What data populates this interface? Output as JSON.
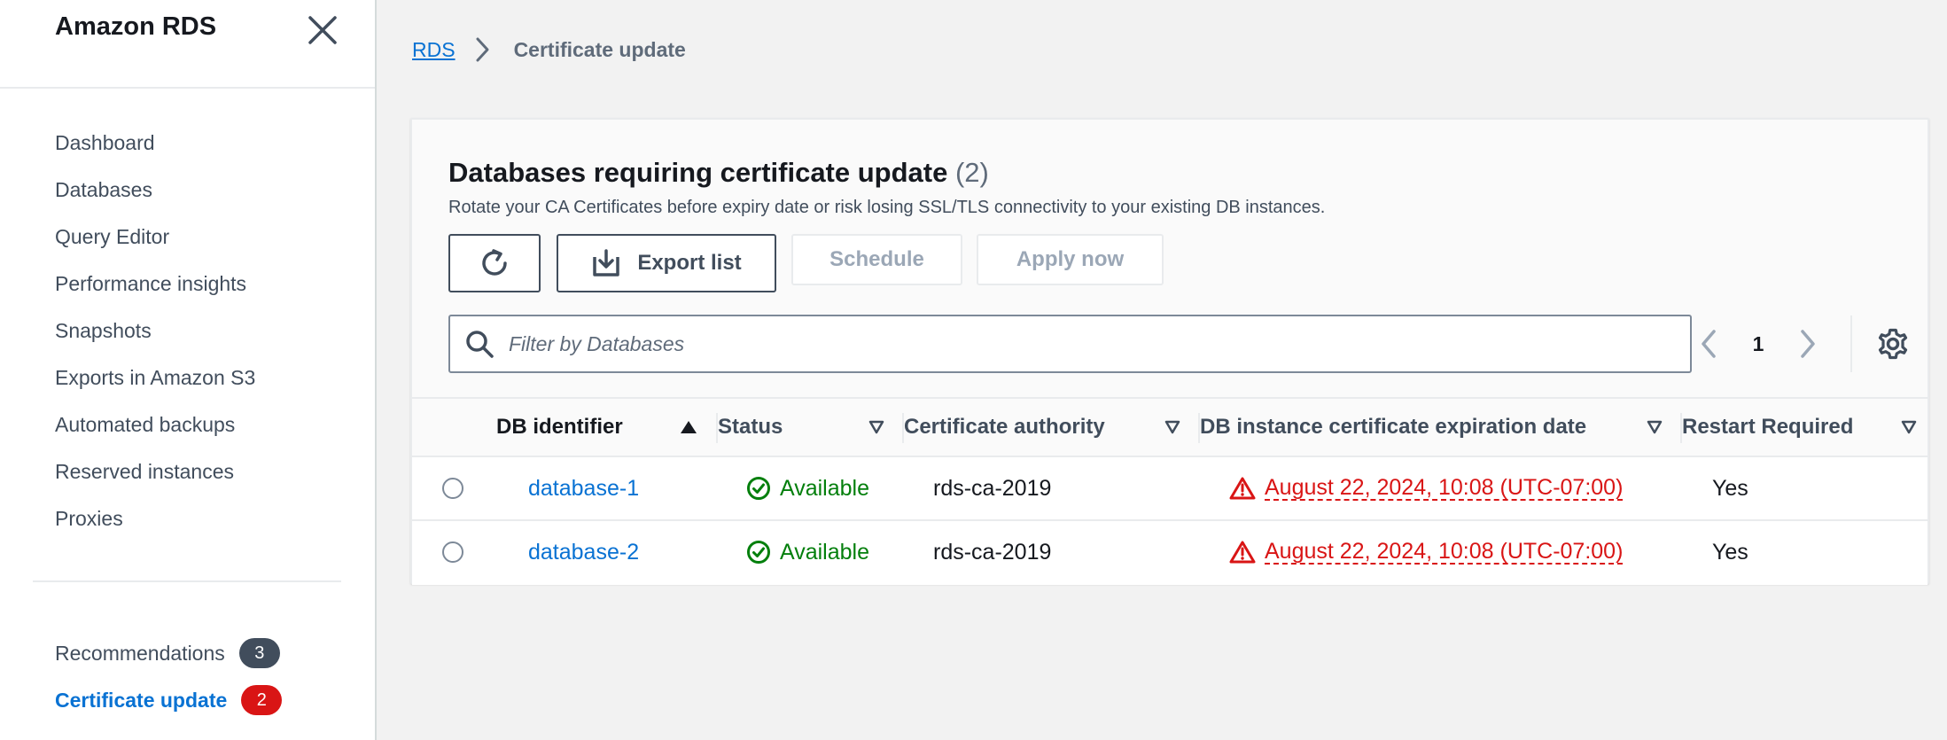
{
  "sidebar": {
    "title": "Amazon RDS",
    "items": [
      {
        "label": "Dashboard"
      },
      {
        "label": "Databases"
      },
      {
        "label": "Query Editor"
      },
      {
        "label": "Performance insights"
      },
      {
        "label": "Snapshots"
      },
      {
        "label": "Exports in Amazon S3"
      },
      {
        "label": "Automated backups"
      },
      {
        "label": "Reserved instances"
      },
      {
        "label": "Proxies"
      }
    ],
    "bottom_items": [
      {
        "label": "Recommendations",
        "badge": "3"
      },
      {
        "label": "Certificate update",
        "badge": "2"
      }
    ]
  },
  "breadcrumb": {
    "root": "RDS",
    "current": "Certificate update"
  },
  "container": {
    "title": "Databases requiring certificate update",
    "count": "(2)",
    "description": "Rotate your CA Certificates before expiry date or risk losing SSL/TLS connectivity to your existing DB instances.",
    "buttons": {
      "export": "Export list",
      "schedule": "Schedule",
      "apply": "Apply now"
    },
    "filter_placeholder": "Filter by Databases",
    "page": "1"
  },
  "table": {
    "columns": {
      "id": "DB identifier",
      "status": "Status",
      "ca": "Certificate authority",
      "exp": "DB instance certificate expiration date",
      "restart": "Restart Required"
    },
    "rows": [
      {
        "id": "database-1",
        "status": "Available",
        "ca": "rds-ca-2019",
        "exp": "August 22, 2024, 10:08 (UTC-07:00)",
        "restart": "Yes"
      },
      {
        "id": "database-2",
        "status": "Available",
        "ca": "rds-ca-2019",
        "exp": "August 22, 2024, 10:08 (UTC-07:00)",
        "restart": "Yes"
      }
    ]
  },
  "colors": {
    "link": "#0972d3",
    "success": "#037f0c",
    "error": "#d91515",
    "badge_grey": "#414d5c"
  }
}
